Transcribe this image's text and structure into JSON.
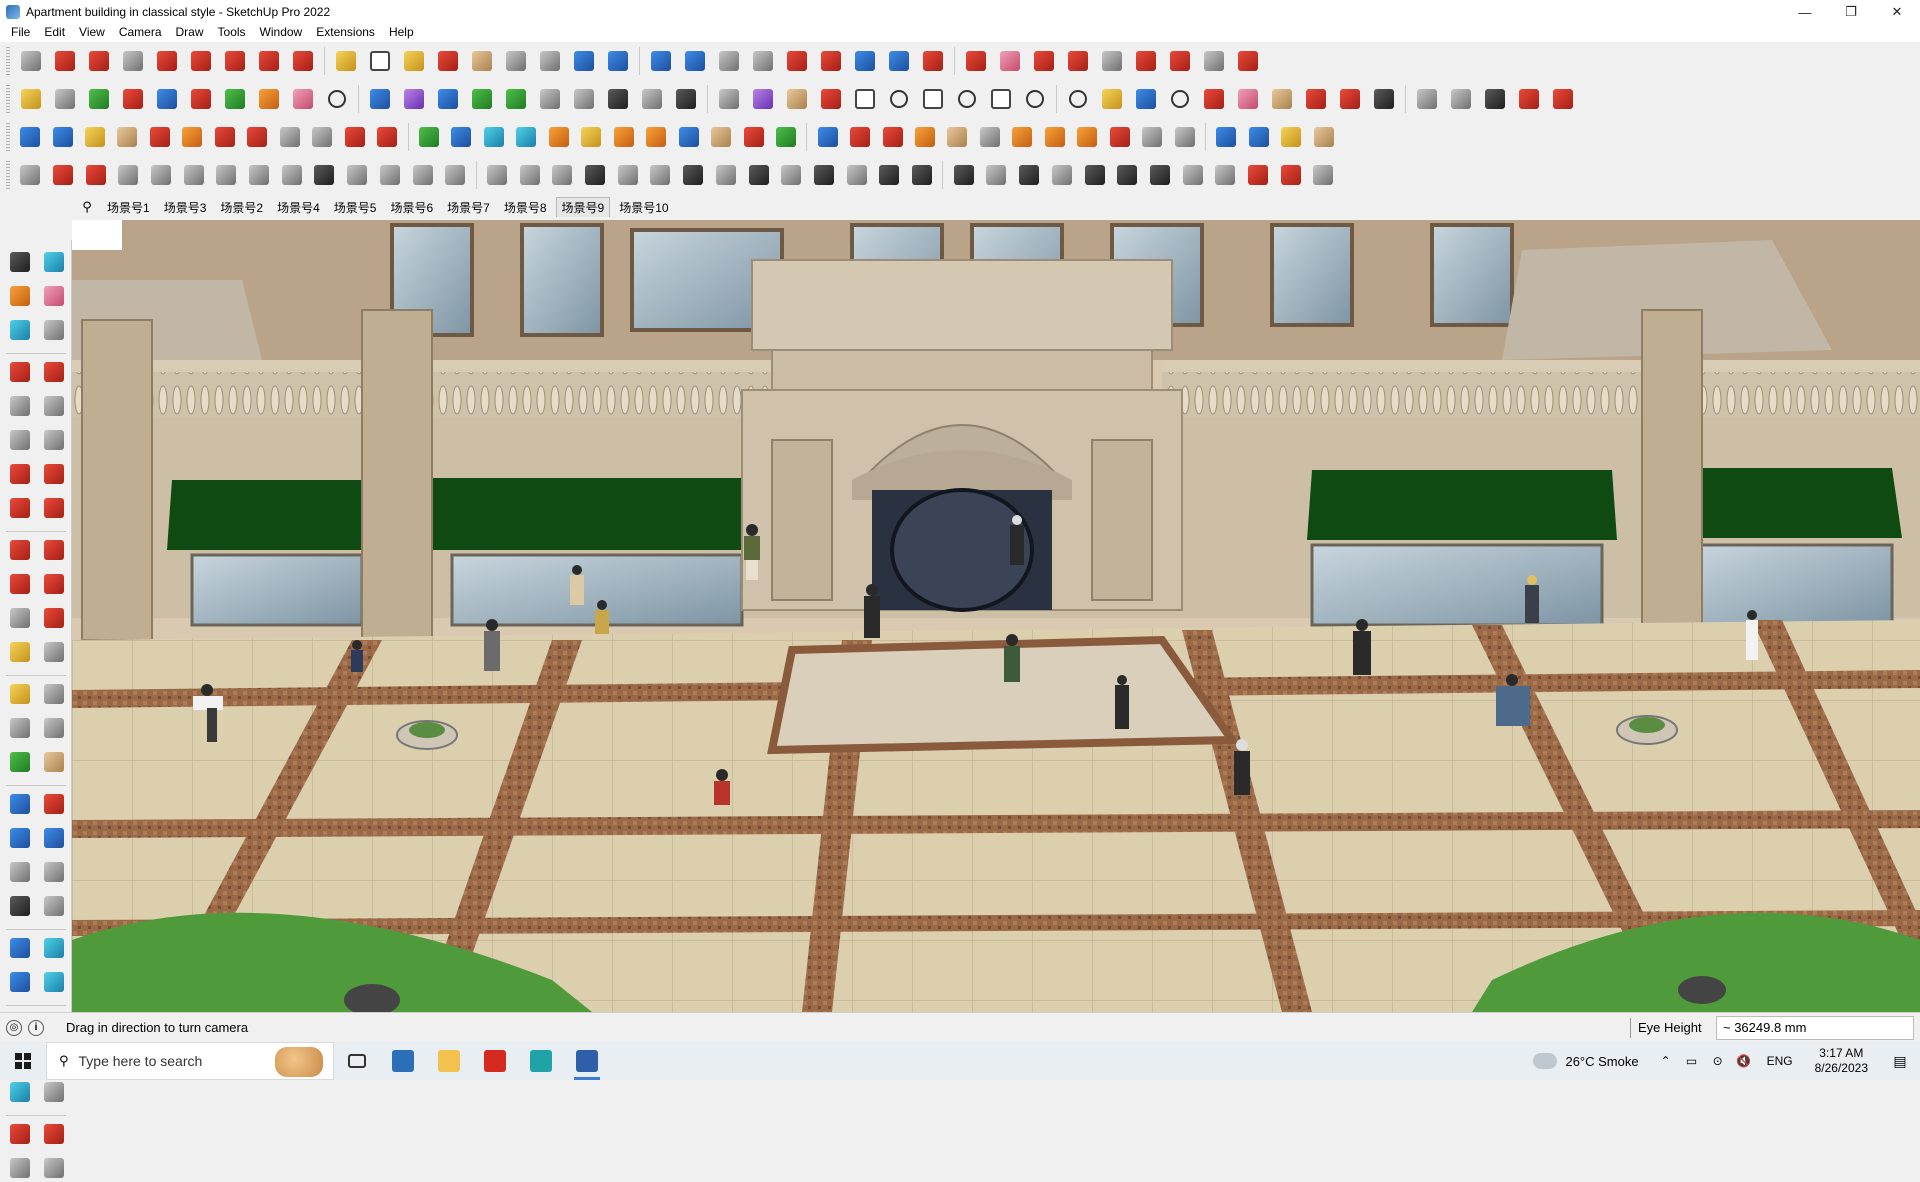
{
  "window": {
    "title": "Apartment building in classical style - SketchUp Pro 2022",
    "controls": {
      "minimize": "—",
      "restore": "❐",
      "close": "✕"
    }
  },
  "menu": [
    "File",
    "Edit",
    "View",
    "Camera",
    "Draw",
    "Tools",
    "Window",
    "Extensions",
    "Help"
  ],
  "scenes": {
    "search_icon": "⚲",
    "tabs": [
      "场景号1",
      "场景号3",
      "场景号2",
      "场景号4",
      "场景号5",
      "场景号6",
      "场景号7",
      "场景号8",
      "场景号9",
      "场景号10"
    ],
    "active": "场景号9"
  },
  "status": {
    "geo_icon": "◎",
    "info_icon": "i",
    "message": "Drag in direction to turn camera",
    "vcb_label": "Eye Height",
    "vcb_value": "~ 36249.8 mm"
  },
  "taskbar": {
    "search_placeholder": "Type here to search",
    "weather": "26°C  Smoke",
    "language": "ENG",
    "time": "3:17 AM",
    "date": "8/26/2023",
    "tray_icons": [
      "⌃",
      "▭",
      "⊙",
      "🔇"
    ],
    "notification_icon": "▤"
  },
  "colors": {
    "awning": "#0f4a12",
    "facade": "#cdbfa6",
    "brick": "#8a5a3c",
    "paving": "#d6c8a6",
    "glass": "#9fb3c0",
    "grass": "#4f9a3a"
  }
}
